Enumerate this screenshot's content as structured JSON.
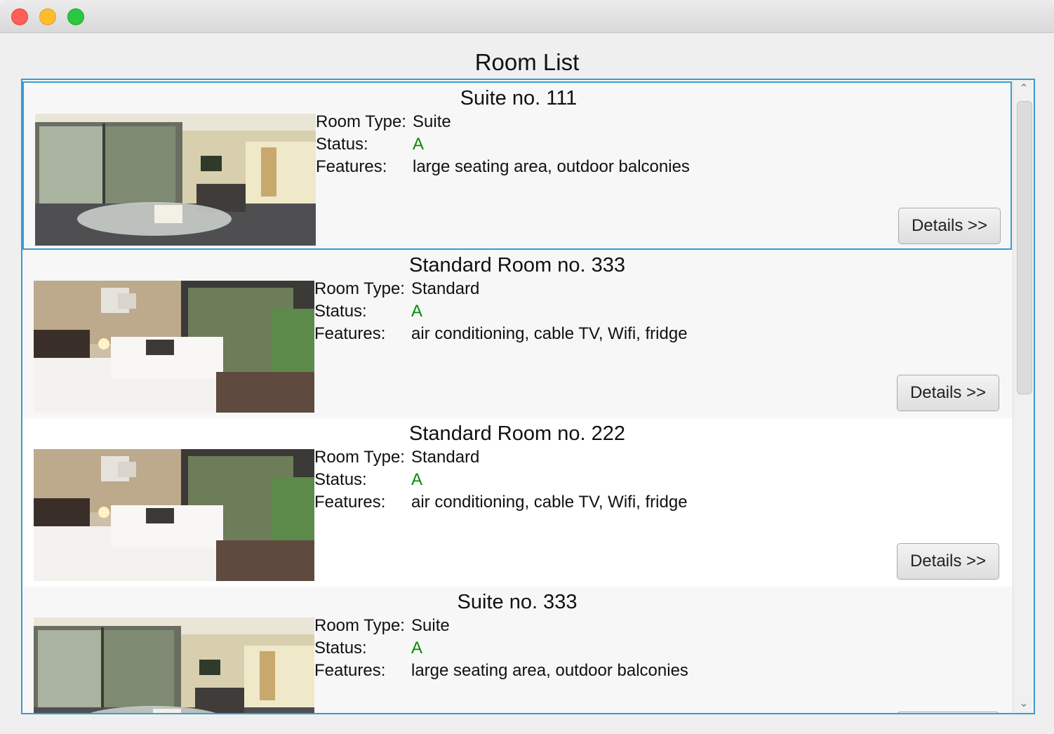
{
  "window": {
    "controls": [
      "close",
      "minimize",
      "maximize"
    ]
  },
  "heading": "Room List",
  "labels": {
    "room_type": "Room Type:",
    "status": "Status:",
    "features": "Features:",
    "details_button": "Details >>"
  },
  "rooms": [
    {
      "title": "Suite no. 111",
      "room_type": "Suite",
      "status": "A",
      "features": "large seating area, outdoor balconies",
      "image": "suite-room-photo",
      "selected": true
    },
    {
      "title": "Standard Room no. 333",
      "room_type": "Standard",
      "status": "A",
      "features": "air conditioning, cable TV, Wifi, fridge",
      "image": "standard-room-photo"
    },
    {
      "title": "Standard Room no. 222",
      "room_type": "Standard",
      "status": "A",
      "features": "air conditioning, cable TV, Wifi, fridge",
      "image": "standard-room-photo"
    },
    {
      "title": "Suite no. 333",
      "room_type": "Suite",
      "status": "A",
      "features": "large seating area, outdoor balconies",
      "image": "suite-room-photo"
    }
  ],
  "colors": {
    "accent": "#3b9bd1",
    "status_available": "#0a8a0a"
  }
}
